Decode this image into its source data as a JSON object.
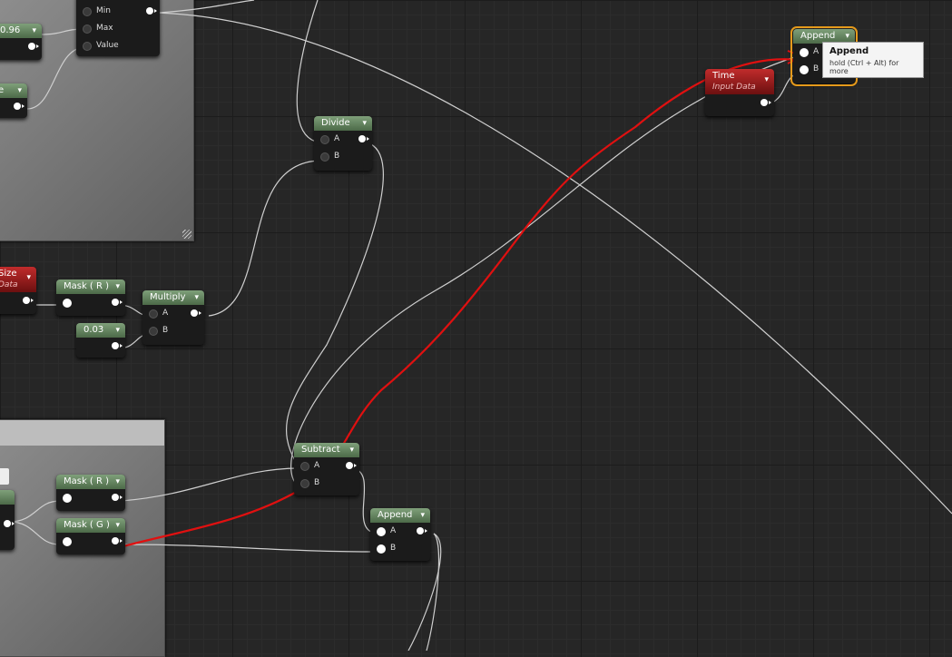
{
  "nodes": {
    "clamp": {
      "pins": [
        "Min",
        "Max",
        "Value"
      ]
    },
    "const_096": {
      "value": "0.96"
    },
    "partial_e": {
      "value": "e"
    },
    "divide": {
      "title": "Divide",
      "pins": [
        "A",
        "B"
      ]
    },
    "append_top": {
      "title": "Append",
      "pins": [
        "A",
        "B"
      ]
    },
    "time": {
      "title": "Time",
      "subtitle": "Input Data"
    },
    "size": {
      "title": "Size",
      "subtitle": "Data"
    },
    "mask_r_top": {
      "title": "Mask ( R )"
    },
    "multiply": {
      "title": "Multiply",
      "pins": [
        "A",
        "B"
      ]
    },
    "const_003": {
      "value": "0.03"
    },
    "mask_r_bottom": {
      "title": "Mask ( R )"
    },
    "mask_g": {
      "title": "Mask ( G )"
    },
    "subtract": {
      "title": "Subtract",
      "pins": [
        "A",
        "B"
      ]
    },
    "append_bottom": {
      "title": "Append",
      "pins": [
        "A",
        "B"
      ]
    }
  },
  "tooltip": {
    "title": "Append",
    "hint": "hold (Ctrl + Alt) for more"
  },
  "colors": {
    "accent_selected": "#e59a1b",
    "annotation_red": "#e01010",
    "node_header": "#5c7c58",
    "param_header": "#a11e1e"
  }
}
